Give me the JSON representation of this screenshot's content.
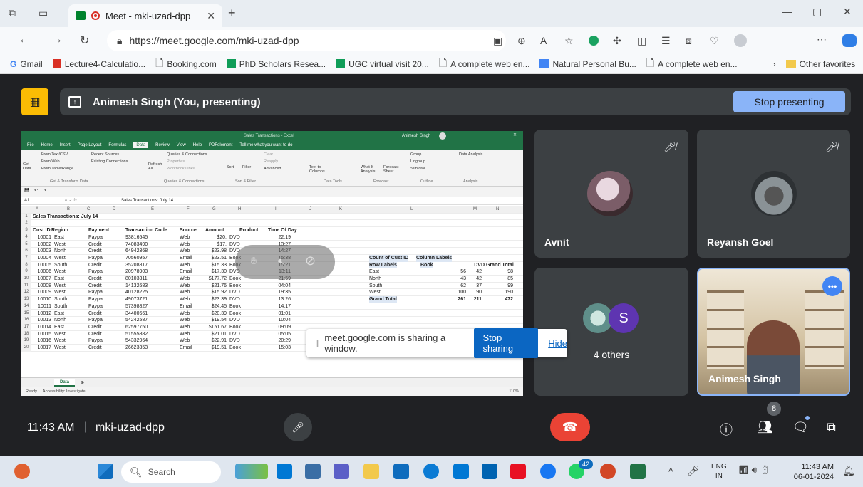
{
  "browser": {
    "tab_title": "Meet - mki-uzad-dpp",
    "url": "https://meet.google.com/mki-uzad-dpp",
    "bookmarks": [
      "Gmail",
      "Lecture4-Calculatio...",
      "Booking.com",
      "PhD Scholars Resea...",
      "UGC virtual visit 20...",
      "A complete web en...",
      "Natural Personal Bu...",
      "A complete web en..."
    ],
    "other_favorites": "Other favorites"
  },
  "meet": {
    "presenting_label": "Animesh Singh (You, presenting)",
    "stop_presenting": "Stop presenting",
    "time": "11:43 AM",
    "separator": "|",
    "meeting_code": "mki-uzad-dpp",
    "share_notice": "meet.google.com is sharing a window.",
    "stop_sharing": "Stop sharing",
    "hide": "Hide",
    "people_count": "8",
    "participants": [
      {
        "name": "Avnit"
      },
      {
        "name": "Reyansh Goel"
      },
      {
        "name": "4 others",
        "avatar_letter": "S"
      },
      {
        "name": "Animesh Singh"
      }
    ]
  },
  "excel": {
    "window_title": "Sales Transactions - Excel",
    "user": "Animesh Singh",
    "tabs": [
      "File",
      "Home",
      "Insert",
      "Page Layout",
      "Formulas",
      "Data",
      "Review",
      "View",
      "Help",
      "PDFelement"
    ],
    "tell_me": "Tell me what you want to do",
    "ribbon_groups": [
      "Get & Transform Data",
      "Queries & Connections",
      "Sort & Filter",
      "Data Tools",
      "Forecast",
      "Outline",
      "Analysis"
    ],
    "ribbon_items": {
      "from_text": "From Text/CSV",
      "from_web": "From Web",
      "from_table": "From Table/Range",
      "recent": "Recent Sources",
      "existing": "Existing Connections",
      "get_data": "Get Data",
      "refresh": "Refresh All",
      "queries": "Queries & Connections",
      "properties": "Properties",
      "edit_links": "Workbook Links",
      "sort": "Sort",
      "filter": "Filter",
      "clear": "Clear",
      "reapply": "Reapply",
      "advanced": "Advanced",
      "text_cols": "Text to Columns",
      "whatif": "What-If Analysis",
      "forecast_sheet": "Forecast Sheet",
      "group": "Group",
      "ungroup": "Ungroup",
      "subtotal": "Subtotal",
      "data_analysis": "Data Analysis"
    },
    "name_box": "A1",
    "formula": "Sales Transactions: July 14",
    "col_letters": [
      "A",
      "B",
      "C",
      "D",
      "E",
      "F",
      "G",
      "H",
      "I",
      "J",
      "K",
      "L",
      "M",
      "N"
    ],
    "title_cell": "Sales Transactions: July 14",
    "headers": [
      "Cust ID",
      "Region",
      "Payment",
      "Transaction Code",
      "Source",
      "Amount",
      "Product",
      "Time Of Day"
    ],
    "rows": [
      [
        "10001",
        "East",
        "Paypal",
        "93816545",
        "Web",
        "$20.",
        "DVD",
        "22:19"
      ],
      [
        "10002",
        "West",
        "Credit",
        "74083490",
        "Web",
        "$17.",
        "DVD",
        "13:27"
      ],
      [
        "10003",
        "North",
        "Credit",
        "64942368",
        "Web",
        "$23.98",
        "DVD",
        "14:27"
      ],
      [
        "10004",
        "West",
        "Paypal",
        "70560957",
        "Email",
        "$23.51",
        "Book",
        "15:38"
      ],
      [
        "10005",
        "South",
        "Credit",
        "35208817",
        "Web",
        "$15.33",
        "Book",
        "15:21"
      ],
      [
        "10006",
        "West",
        "Paypal",
        "20978903",
        "Email",
        "$17.30",
        "DVD",
        "13:11"
      ],
      [
        "10007",
        "East",
        "Credit",
        "80103311",
        "Web",
        "$177.72",
        "Book",
        "21:59"
      ],
      [
        "10008",
        "West",
        "Credit",
        "14132683",
        "Web",
        "$21.76",
        "Book",
        "04:04"
      ],
      [
        "10009",
        "West",
        "Paypal",
        "40128225",
        "Web",
        "$15.92",
        "DVD",
        "19:35"
      ],
      [
        "10010",
        "South",
        "Paypal",
        "49073721",
        "Web",
        "$23.39",
        "DVD",
        "13:26"
      ],
      [
        "10011",
        "South",
        "Paypal",
        "57398827",
        "Email",
        "$24.45",
        "Book",
        "14:17"
      ],
      [
        "10012",
        "East",
        "Credit",
        "34400661",
        "Web",
        "$20.39",
        "Book",
        "01:01"
      ],
      [
        "10013",
        "North",
        "Paypal",
        "54242587",
        "Web",
        "$19.54",
        "DVD",
        "10:04"
      ],
      [
        "10014",
        "East",
        "Credit",
        "62597750",
        "Web",
        "$151.67",
        "Book",
        "09:09"
      ],
      [
        "10015",
        "West",
        "Credit",
        "51555882",
        "Web",
        "$21.01",
        "DVD",
        "05:05"
      ],
      [
        "10016",
        "West",
        "Paypal",
        "54332964",
        "Web",
        "$22.91",
        "DVD",
        "20:29"
      ],
      [
        "10017",
        "West",
        "Credit",
        "26623353",
        "Email",
        "$19.51",
        "Book",
        "15:03"
      ]
    ],
    "pivot": {
      "title": "Count of Cust ID",
      "col_labels": "Column Labels",
      "row_labels": "Row Labels",
      "col_headers": [
        "Book",
        "DVD",
        "Grand Total"
      ],
      "rows": [
        [
          "East",
          "56",
          "42",
          "98"
        ],
        [
          "North",
          "43",
          "42",
          "85"
        ],
        [
          "South",
          "62",
          "37",
          "99"
        ],
        [
          "West",
          "100",
          "90",
          "190"
        ],
        [
          "Grand Total",
          "261",
          "211",
          "472"
        ]
      ]
    },
    "sheet_tab": "Data",
    "status_ready": "Ready",
    "status_access": "Accessibility: Investigate",
    "zoom": "110%"
  },
  "taskbar": {
    "search_placeholder": "Search",
    "lang1": "ENG",
    "lang2": "IN",
    "time": "11:43 AM",
    "date": "06-01-2024",
    "badge": "42"
  },
  "colors": {
    "meet_bg": "#202124",
    "tile_bg": "#3c4043",
    "accent": "#8ab4f8",
    "excel_green": "#217346",
    "hangup": "#ea4335"
  }
}
